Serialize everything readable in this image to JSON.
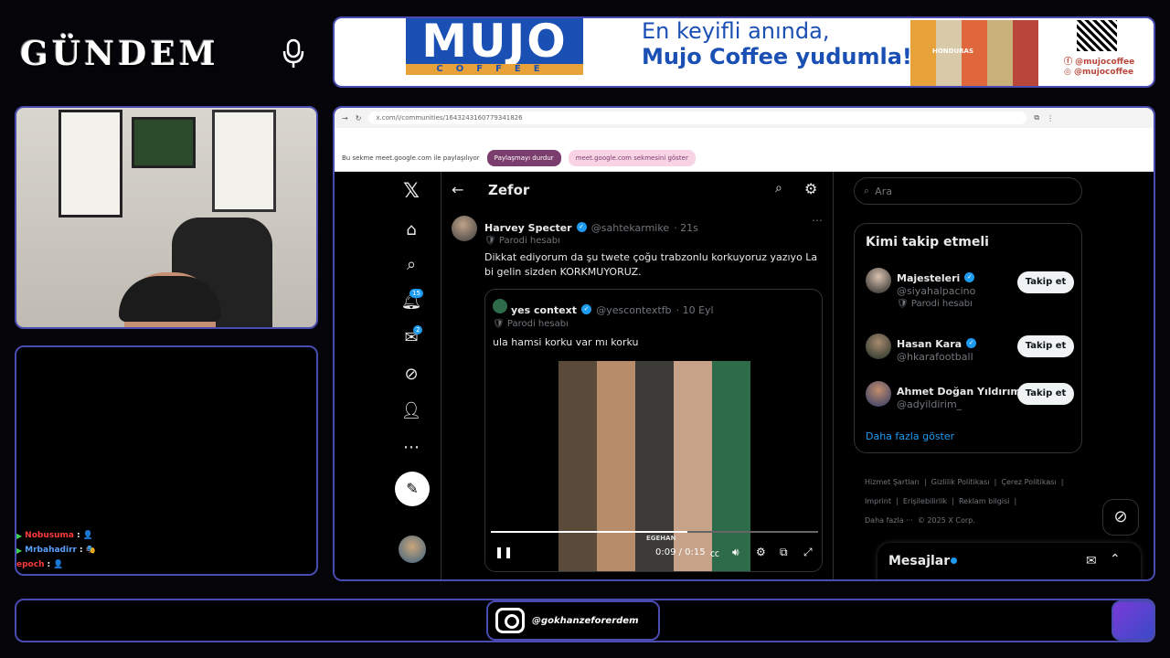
{
  "overlay": {
    "logo": "GÜNDEM",
    "instagram": "@gokhanzeforerdem"
  },
  "chat": [
    {
      "user": "Nobusuma",
      "color": "#ff3b3b"
    },
    {
      "user": "Mrbahadirr",
      "color": "#5aa0ff"
    },
    {
      "user": "epoch",
      "color": "#ff3b3b"
    }
  ],
  "banner": {
    "brand": "MUJO",
    "brand_sub": "COFFEE",
    "line1": "En keyifli anında,",
    "line2": "Mujo Coffee yudumla!",
    "facebook": "@mujocoffee",
    "instagram": "@mujocoffee",
    "pack_label": "HONDURAS"
  },
  "browser": {
    "url": "x.com/i/communities/1643243160779341826",
    "share_text": "Bu sekme meet.google.com ile paylaşılıyor",
    "stop_share": "Paylaşmayı durdur",
    "show_tab": "meet.google.com sekmesini göster"
  },
  "x": {
    "header_title": "Zefor",
    "badges": {
      "notifications": "15",
      "messages": "2"
    },
    "tweet": {
      "name": "Harvey Specter",
      "handle": "@sahtekarmike",
      "time": "· 21s",
      "label": "Parodi hesabı",
      "text": "Dikkat ediyorum da şu twete çoğu trabzonlu korkuyoruz yazıyo La bi gelin sizden KORKMUYORUZ.",
      "quote": {
        "name": "yes context",
        "handle": "@yescontextfb",
        "time": "· 10 Eyl",
        "label": "Parodi hesabı",
        "text": "ula hamsi korku var mı korku",
        "video_time": "0:09 / 0:15",
        "video_caption": "EGEHAN",
        "progress": 0.6
      }
    },
    "search_placeholder": "Ara",
    "who_to_follow": {
      "title": "Kimi takip etmeli",
      "follow_label": "Takip et",
      "users": [
        {
          "name": "Majesteleri",
          "handle": "@siyahalpacino",
          "label": "Parodi hesabı"
        },
        {
          "name": "Hasan Kara",
          "handle": "@hkarafootball",
          "label": ""
        },
        {
          "name": "Ahmet Doğan Yıldırım",
          "handle": "@adyildirim_",
          "label": ""
        }
      ],
      "show_more": "Daha fazla göster"
    },
    "footer": {
      "links": [
        "Hizmet Şartları",
        "Gizlilik Politikası",
        "Çerez Politikası",
        "Imprint",
        "Erişilebilirlik",
        "Reklam bilgisi",
        "Daha fazla ···"
      ],
      "copyright": "© 2025 X Corp."
    },
    "messages": "Mesajlar"
  },
  "colors": {
    "accent": "#1d9bf0",
    "frame": "#4a4bb0",
    "brand_blue": "#1a4fb4"
  }
}
